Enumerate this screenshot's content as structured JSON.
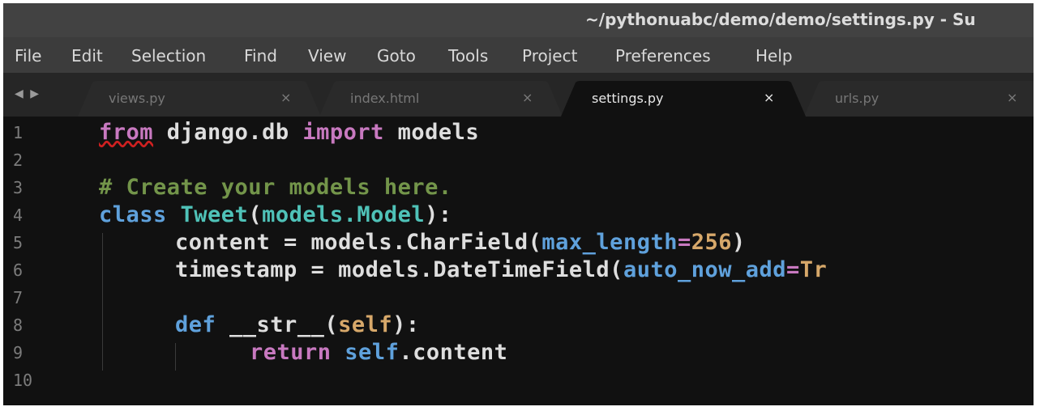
{
  "window": {
    "title": "~/pythonuabc/demo/demo/settings.py - Su"
  },
  "menu": {
    "items": [
      "File",
      "Edit",
      "Selection",
      "Find",
      "View",
      "Goto",
      "Tools",
      "Project",
      "Preferences",
      "Help"
    ]
  },
  "tabs": {
    "nav": "◀ ▶",
    "close_glyph": "×",
    "items": [
      {
        "label": "views.py",
        "active": false
      },
      {
        "label": "index.html",
        "active": false
      },
      {
        "label": "settings.py",
        "active": true
      },
      {
        "label": "urls.py",
        "active": false
      }
    ]
  },
  "editor": {
    "line_numbers": [
      "1",
      "2",
      "3",
      "4",
      "5",
      "6",
      "7",
      "8",
      "9",
      "10"
    ],
    "code": {
      "l1_from": "from",
      "l1_mod": " django.db ",
      "l1_import": "import",
      "l1_rest": " models",
      "l3_comment": "# Create your models here.",
      "l4_class": "class",
      "l4_name": " Tweet",
      "l4_paren": "(",
      "l4_base": "models.Model",
      "l4_end": "):",
      "l5_a": "content = models.CharField(",
      "l5_kw": "max_length",
      "l5_eq": "=",
      "l5_num": "256",
      "l5_end": ")",
      "l6_a": "timestamp = models.DateTimeField(",
      "l6_kw": "auto_now_add",
      "l6_eq": "=",
      "l6_val": "Tr",
      "l8_def": "def",
      "l8_name": " __str__(",
      "l8_self": "self",
      "l8_end": "):",
      "l9_ret": "return",
      "l9_self": " self",
      "l9_end": ".content"
    }
  },
  "colors": {
    "keyword": "#c879c0",
    "storage": "#5fa1dc",
    "class_name": "#4fc2b8",
    "comment": "#73954a",
    "number": "#d7a86a"
  }
}
